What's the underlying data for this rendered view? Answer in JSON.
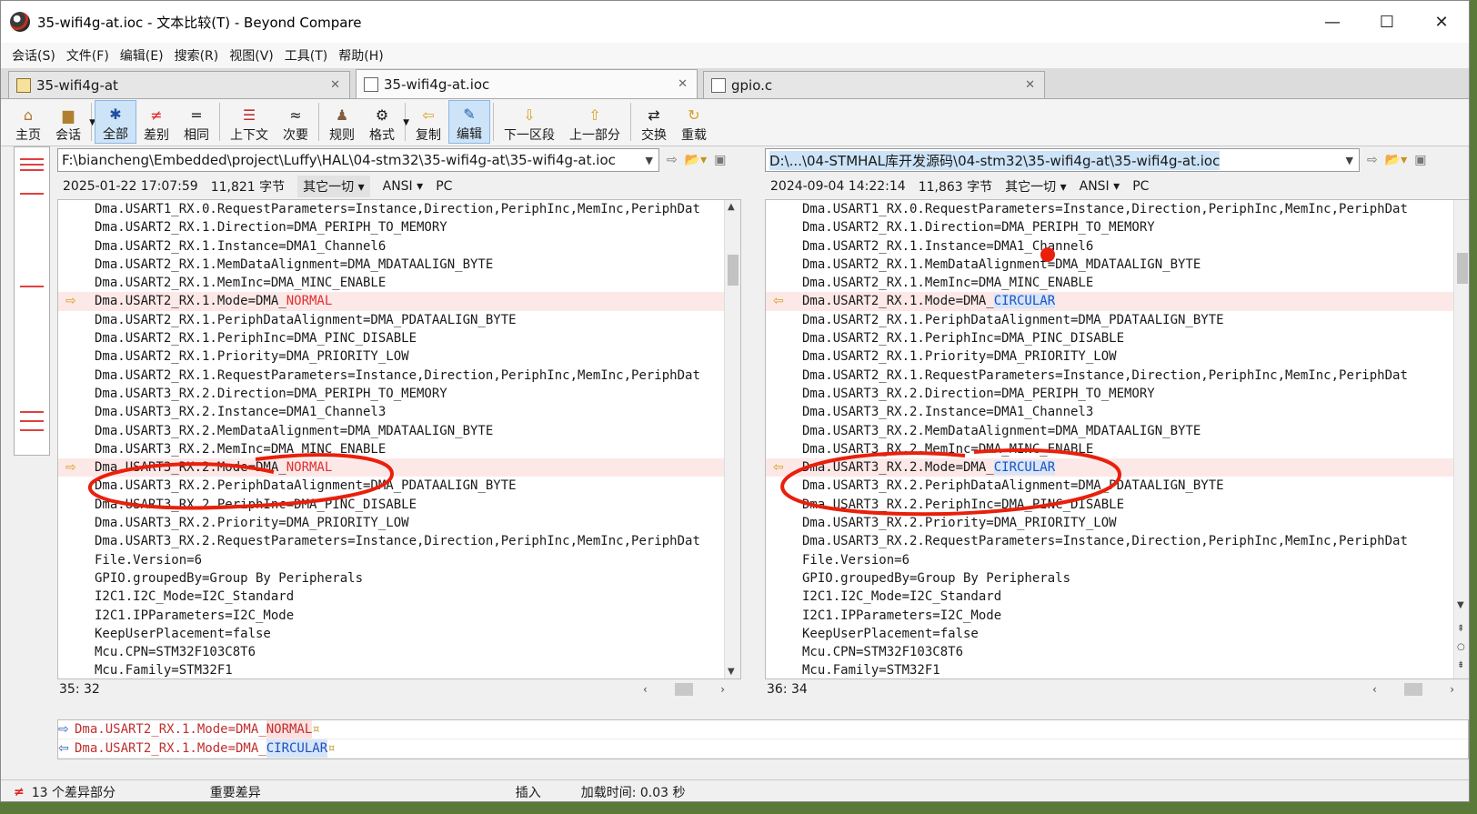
{
  "window": {
    "title": "35-wifi4g-at.ioc - 文本比较(T) - Beyond Compare"
  },
  "window_controls": {
    "minimize": "—",
    "maximize": "☐",
    "close": "✕"
  },
  "menu": [
    "会话(S)",
    "文件(F)",
    "编辑(E)",
    "搜索(R)",
    "视图(V)",
    "工具(T)",
    "帮助(H)"
  ],
  "tabs": [
    {
      "label": "35-wifi4g-at",
      "icon": "folder-compare-icon"
    },
    {
      "label": "35-wifi4g-at.ioc",
      "icon": "text-compare-icon"
    },
    {
      "label": "gpio.c",
      "icon": "text-compare-icon"
    }
  ],
  "toolbar": {
    "home": "主页",
    "session": "会话",
    "all": "全部",
    "diffs": "差别",
    "same": "相同",
    "context": "上下文",
    "minor": "次要",
    "rules": "规则",
    "format": "格式",
    "copy": "复制",
    "edit": "编辑",
    "next_section": "下一区段",
    "prev_section": "上一部分",
    "swap": "交换",
    "reload": "重载"
  },
  "left": {
    "path": "F:\\biancheng\\Embedded\\project\\Luffy\\HAL\\04-stm32\\35-wifi4g-at\\35-wifi4g-at.ioc",
    "timestamp": "2025-01-22 17:07:59",
    "size": "11,821 字节",
    "filter": "其它一切",
    "encoding": "ANSI",
    "line_ending": "PC",
    "position": "35: 32",
    "lines": [
      {
        "text": "Dma.USART1_RX.0.RequestParameters=Instance,Direction,PeriphInc,MemInc,PeriphDat",
        "suffix": "",
        "diff": false
      },
      {
        "text": "Dma.USART2_RX.1.Direction=DMA_PERIPH_TO_MEMORY",
        "suffix": "",
        "diff": false
      },
      {
        "text": "Dma.USART2_RX.1.Instance=DMA1_Channel6",
        "suffix": "",
        "diff": false
      },
      {
        "text": "Dma.USART2_RX.1.MemDataAlignment=DMA_MDATAALIGN_BYTE",
        "suffix": "",
        "diff": false
      },
      {
        "text": "Dma.USART2_RX.1.MemInc=DMA_MINC_ENABLE",
        "suffix": "",
        "diff": false
      },
      {
        "text": "Dma.USART2_RX.1.Mode=DMA_",
        "suffix": "NORMAL",
        "diff": true
      },
      {
        "text": "Dma.USART2_RX.1.PeriphDataAlignment=DMA_PDATAALIGN_BYTE",
        "suffix": "",
        "diff": false
      },
      {
        "text": "Dma.USART2_RX.1.PeriphInc=DMA_PINC_DISABLE",
        "suffix": "",
        "diff": false
      },
      {
        "text": "Dma.USART2_RX.1.Priority=DMA_PRIORITY_LOW",
        "suffix": "",
        "diff": false
      },
      {
        "text": "Dma.USART2_RX.1.RequestParameters=Instance,Direction,PeriphInc,MemInc,PeriphDat",
        "suffix": "",
        "diff": false
      },
      {
        "text": "Dma.USART3_RX.2.Direction=DMA_PERIPH_TO_MEMORY",
        "suffix": "",
        "diff": false
      },
      {
        "text": "Dma.USART3_RX.2.Instance=DMA1_Channel3",
        "suffix": "",
        "diff": false
      },
      {
        "text": "Dma.USART3_RX.2.MemDataAlignment=DMA_MDATAALIGN_BYTE",
        "suffix": "",
        "diff": false
      },
      {
        "text": "Dma.USART3_RX.2.MemInc=DMA_MINC_ENABLE",
        "suffix": "",
        "diff": false
      },
      {
        "text": "Dma.USART3_RX.2.Mode=DMA_",
        "suffix": "NORMAL",
        "diff": true
      },
      {
        "text": "Dma.USART3_RX.2.PeriphDataAlignment=DMA_PDATAALIGN_BYTE",
        "suffix": "",
        "diff": false
      },
      {
        "text": "Dma.USART3_RX.2.PeriphInc=DMA_PINC_DISABLE",
        "suffix": "",
        "diff": false
      },
      {
        "text": "Dma.USART3_RX.2.Priority=DMA_PRIORITY_LOW",
        "suffix": "",
        "diff": false
      },
      {
        "text": "Dma.USART3_RX.2.RequestParameters=Instance,Direction,PeriphInc,MemInc,PeriphDat",
        "suffix": "",
        "diff": false
      },
      {
        "text": "File.Version=6",
        "suffix": "",
        "diff": false
      },
      {
        "text": "GPIO.groupedBy=Group By Peripherals",
        "suffix": "",
        "diff": false
      },
      {
        "text": "I2C1.I2C_Mode=I2C_Standard",
        "suffix": "",
        "diff": false
      },
      {
        "text": "I2C1.IPParameters=I2C_Mode",
        "suffix": "",
        "diff": false
      },
      {
        "text": "KeepUserPlacement=false",
        "suffix": "",
        "diff": false
      },
      {
        "text": "Mcu.CPN=STM32F103C8T6",
        "suffix": "",
        "diff": false
      },
      {
        "text": "Mcu.Family=STM32F1",
        "suffix": "",
        "diff": false
      }
    ]
  },
  "right": {
    "path": "D:\\...\\04-STMHAL库开发源码\\04-stm32\\35-wifi4g-at\\35-wifi4g-at.ioc",
    "timestamp": "2024-09-04 14:22:14",
    "size": "11,863 字节",
    "filter": "其它一切",
    "encoding": "ANSI",
    "line_ending": "PC",
    "position": "36: 34",
    "lines": [
      {
        "text": "Dma.USART1_RX.0.RequestParameters=Instance,Direction,PeriphInc,MemInc,PeriphDat",
        "suffix": "",
        "diff": false
      },
      {
        "text": "Dma.USART2_RX.1.Direction=DMA_PERIPH_TO_MEMORY",
        "suffix": "",
        "diff": false
      },
      {
        "text": "Dma.USART2_RX.1.Instance=DMA1_Channel6",
        "suffix": "",
        "diff": false
      },
      {
        "text": "Dma.USART2_RX.1.MemDataAlignment=DMA_MDATAALIGN_BYTE",
        "suffix": "",
        "diff": false
      },
      {
        "text": "Dma.USART2_RX.1.MemInc=DMA_MINC_ENABLE",
        "suffix": "",
        "diff": false
      },
      {
        "text": "Dma.USART2_RX.1.Mode=DMA_",
        "suffix": "CIRCULAR",
        "diff": true
      },
      {
        "text": "Dma.USART2_RX.1.PeriphDataAlignment=DMA_PDATAALIGN_BYTE",
        "suffix": "",
        "diff": false
      },
      {
        "text": "Dma.USART2_RX.1.PeriphInc=DMA_PINC_DISABLE",
        "suffix": "",
        "diff": false
      },
      {
        "text": "Dma.USART2_RX.1.Priority=DMA_PRIORITY_LOW",
        "suffix": "",
        "diff": false
      },
      {
        "text": "Dma.USART2_RX.1.RequestParameters=Instance,Direction,PeriphInc,MemInc,PeriphDat",
        "suffix": "",
        "diff": false
      },
      {
        "text": "Dma.USART3_RX.2.Direction=DMA_PERIPH_TO_MEMORY",
        "suffix": "",
        "diff": false
      },
      {
        "text": "Dma.USART3_RX.2.Instance=DMA1_Channel3",
        "suffix": "",
        "diff": false
      },
      {
        "text": "Dma.USART3_RX.2.MemDataAlignment=DMA_MDATAALIGN_BYTE",
        "suffix": "",
        "diff": false
      },
      {
        "text": "Dma.USART3_RX.2.MemInc=DMA_MINC_ENABLE",
        "suffix": "",
        "diff": false
      },
      {
        "text": "Dma.USART3_RX.2.Mode=DMA_",
        "suffix": "CIRCULAR",
        "diff": true
      },
      {
        "text": "Dma.USART3_RX.2.PeriphDataAlignment=DMA_PDATAALIGN_BYTE",
        "suffix": "",
        "diff": false
      },
      {
        "text": "Dma.USART3_RX.2.PeriphInc=DMA_PINC_DISABLE",
        "suffix": "",
        "diff": false
      },
      {
        "text": "Dma.USART3_RX.2.Priority=DMA_PRIORITY_LOW",
        "suffix": "",
        "diff": false
      },
      {
        "text": "Dma.USART3_RX.2.RequestParameters=Instance,Direction,PeriphInc,MemInc,PeriphDat",
        "suffix": "",
        "diff": false
      },
      {
        "text": "File.Version=6",
        "suffix": "",
        "diff": false
      },
      {
        "text": "GPIO.groupedBy=Group By Peripherals",
        "suffix": "",
        "diff": false
      },
      {
        "text": "I2C1.I2C_Mode=I2C_Standard",
        "suffix": "",
        "diff": false
      },
      {
        "text": "I2C1.IPParameters=I2C_Mode",
        "suffix": "",
        "diff": false
      },
      {
        "text": "KeepUserPlacement=false",
        "suffix": "",
        "diff": false
      },
      {
        "text": "Mcu.CPN=STM32F103C8T6",
        "suffix": "",
        "diff": false
      },
      {
        "text": "Mcu.Family=STM32F1",
        "suffix": "",
        "diff": false
      }
    ]
  },
  "detail": {
    "left_prefix": "Dma.USART2_RX.1.Mode=DMA_",
    "left_suffix": "NORMAL",
    "right_prefix": "Dma.USART2_RX.1.Mode=DMA_",
    "right_suffix": "CIRCULAR",
    "eol_mark": "¤"
  },
  "status": {
    "diff_count": "13 个差异部分",
    "diff_type": "重要差异",
    "mode": "插入",
    "load_time": "加载时间:  0.03 秒"
  },
  "colors": {
    "diff_bg": "#fde8e8",
    "left_change": "#e03030",
    "right_change": "#2050c0",
    "annotation": "#e8200c"
  }
}
